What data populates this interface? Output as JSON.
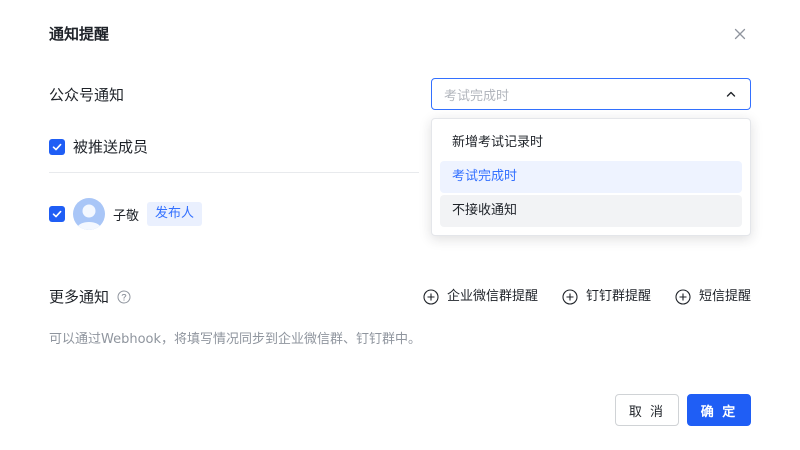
{
  "dialog": {
    "title": "通知提醒",
    "close_icon": "close-icon"
  },
  "official_account": {
    "label": "公众号通知",
    "select_placeholder": "考试完成时",
    "options": [
      {
        "label": "新增考试记录时",
        "state": "normal"
      },
      {
        "label": "考试完成时",
        "state": "selected"
      },
      {
        "label": "不接收通知",
        "state": "hover"
      }
    ]
  },
  "pushed_members": {
    "label": "被推送成员",
    "checked": true,
    "members": [
      {
        "name": "子敬",
        "badge": "发布人",
        "checked": true
      }
    ]
  },
  "more": {
    "title": "更多通知",
    "help_icon": "question-circle-icon",
    "actions": [
      "企业微信群提醒",
      "钉钉群提醒",
      "短信提醒"
    ],
    "hint": "可以通过Webhook，将填写情况同步到企业微信群、钉钉群中。"
  },
  "footer": {
    "cancel_label": "取 消",
    "ok_label": "确 定"
  },
  "colors": {
    "primary": "#1f5ef5",
    "link_blue": "#3370ff",
    "text": "#1f2329",
    "muted": "#8f959e"
  }
}
